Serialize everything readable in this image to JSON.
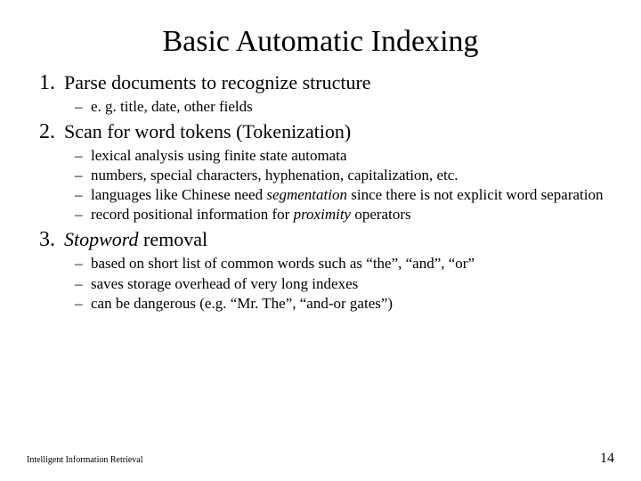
{
  "title": "Basic Automatic Indexing",
  "items": [
    {
      "num": "1.",
      "text_parts": [
        {
          "t": "Parse documents to recognize structure",
          "i": false
        }
      ],
      "subs": [
        [
          {
            "t": "e. g. title, date, other fields",
            "i": false
          }
        ]
      ]
    },
    {
      "num": "2.",
      "text_parts": [
        {
          "t": "Scan for word tokens (Tokenization)",
          "i": false
        }
      ],
      "subs": [
        [
          {
            "t": "lexical analysis using finite state automata",
            "i": false
          }
        ],
        [
          {
            "t": "numbers, special characters, hyphenation, capitalization, etc.",
            "i": false
          }
        ],
        [
          {
            "t": "languages like Chinese need ",
            "i": false
          },
          {
            "t": "segmentation",
            "i": true
          },
          {
            "t": " since there is not explicit word separation",
            "i": false
          }
        ],
        [
          {
            "t": "record positional information for ",
            "i": false
          },
          {
            "t": "proximity",
            "i": true
          },
          {
            "t": " operators",
            "i": false
          }
        ]
      ]
    },
    {
      "num": "3.",
      "text_parts": [
        {
          "t": "Stopword",
          "i": true
        },
        {
          "t": " removal",
          "i": false
        }
      ],
      "subs": [
        [
          {
            "t": "based on short list of common words such as “the”, “and”, “or”",
            "i": false
          }
        ],
        [
          {
            "t": "saves storage overhead of very long indexes",
            "i": false
          }
        ],
        [
          {
            "t": "can be dangerous (e.g. “Mr. The”, “and-or gates”)",
            "i": false
          }
        ]
      ]
    }
  ],
  "footer_left": "Intelligent Information Retrieval",
  "footer_right": "14"
}
